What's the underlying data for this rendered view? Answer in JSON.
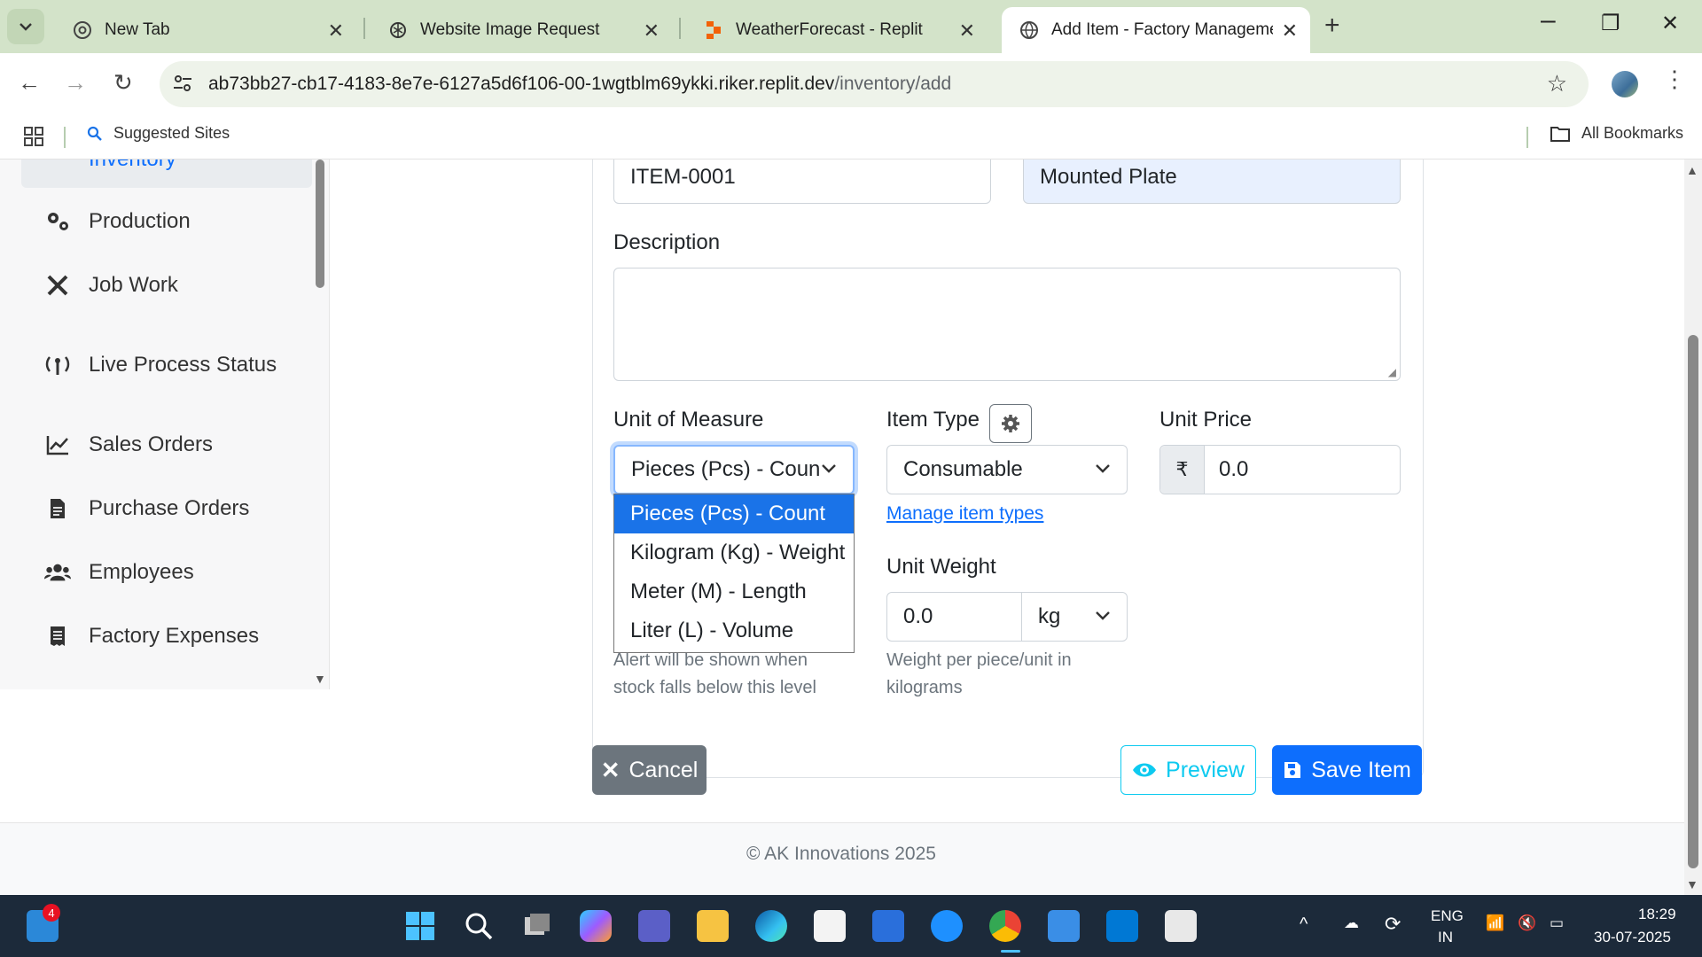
{
  "browser": {
    "tabs": [
      {
        "title": "New Tab"
      },
      {
        "title": "Website Image Request"
      },
      {
        "title": "WeatherForecast - Replit"
      },
      {
        "title": "Add Item - Factory Managemen"
      }
    ],
    "url_host": "ab73bb27-cb17-4183-8e7e-6127a5d6f106-00-1wgtblm69ykki.riker.replit.dev",
    "url_path": "/inventory/add",
    "bookmarks": {
      "suggested": "Suggested Sites",
      "all": "All Bookmarks"
    }
  },
  "sidebar": {
    "active": "Inventory",
    "items": [
      {
        "label": "Production",
        "icon": "gears-icon"
      },
      {
        "label": "Job Work",
        "icon": "tools-icon"
      },
      {
        "label": "Live Process Status",
        "icon": "broadcast-icon"
      },
      {
        "label": "Sales Orders",
        "icon": "line-chart-icon"
      },
      {
        "label": "Purchase Orders",
        "icon": "document-icon"
      },
      {
        "label": "Employees",
        "icon": "users-icon"
      },
      {
        "label": "Factory Expenses",
        "icon": "receipt-icon"
      }
    ]
  },
  "form": {
    "item_code": "ITEM-0001",
    "item_name": "Mounted Plate",
    "description_label": "Description",
    "description_value": "",
    "uom_label": "Unit of Measure",
    "uom_value": "Pieces (Pcs) - Coun",
    "uom_options": [
      "Pieces (Pcs) - Count",
      "Kilogram (Kg) - Weight",
      "Meter (M) - Length",
      "Liter (L) - Volume"
    ],
    "uom_selected_index": 0,
    "item_type_label": "Item Type",
    "item_type_value": "Consumable",
    "manage_item_types": "Manage item types",
    "unit_price_label": "Unit Price",
    "currency_symbol": "₹",
    "unit_price_value": "0.0",
    "unit_weight_label": "Unit Weight",
    "unit_weight_value": "0.0",
    "unit_weight_unit": "kg",
    "unit_weight_help": "Weight per piece/unit in kilograms",
    "min_stock_help": "Alert will be shown when stock falls below this level"
  },
  "buttons": {
    "cancel": "Cancel",
    "preview": "Preview",
    "save": "Save Item"
  },
  "footer": {
    "copyright": "© AK Innovations 2025"
  },
  "taskbar": {
    "notification_count": "4",
    "lang_top": "ENG",
    "lang_bottom": "IN",
    "time": "18:29",
    "date": "30-07-2025"
  },
  "colors": {
    "primary": "#0d6efd",
    "secondary": "#6c757d",
    "info": "#0dcaf0",
    "chrome_frame": "#d3e3c9"
  }
}
